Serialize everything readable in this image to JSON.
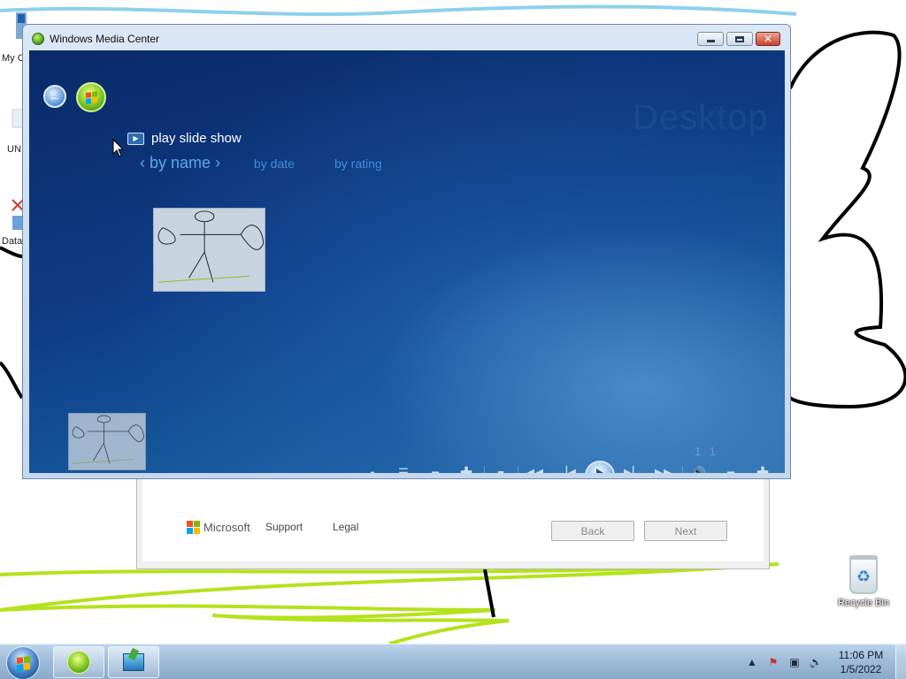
{
  "desktop": {
    "icons": [
      {
        "label": "My C"
      },
      {
        "label": "UN"
      },
      {
        "label": "Data"
      },
      {
        "label": "Recycle Bin"
      }
    ],
    "background": "#ffffff",
    "drawing_colors": {
      "blue": "#8fd0ec",
      "black": "#000000",
      "green": "#b4e21c"
    }
  },
  "setup_dialog": {
    "brand": "Microsoft",
    "links": [
      "Support",
      "Legal"
    ],
    "buttons": {
      "back": "Back",
      "next": "Next"
    },
    "logo_colors": [
      "#f25022",
      "#7fba00",
      "#00a4ef",
      "#ffb900"
    ]
  },
  "media_center": {
    "window_title": "Windows Media Center",
    "window_buttons": {
      "close": "✕"
    },
    "watermark": "Desktop",
    "slide_show_label": "play slide show",
    "sort": {
      "active": "by name",
      "options": [
        "by date",
        "by rating"
      ]
    },
    "pager": {
      "current": "1",
      "total": "1"
    },
    "controls": [
      "record-icon",
      "guide-icon",
      "channel-down-icon",
      "channel-up-icon",
      "stop-icon",
      "rewind-icon",
      "previous-icon",
      "play-icon",
      "next-icon",
      "fast-forward-icon",
      "mute-icon",
      "volume-down-icon",
      "volume-up-icon"
    ],
    "colors": {
      "background_dark": "#0a2a68",
      "accent": "#5ba8ea"
    }
  },
  "taskbar": {
    "clock_time": "11:06 PM",
    "clock_date": "1/5/2022",
    "tasks": [
      "windows-media-center",
      "setup"
    ]
  }
}
